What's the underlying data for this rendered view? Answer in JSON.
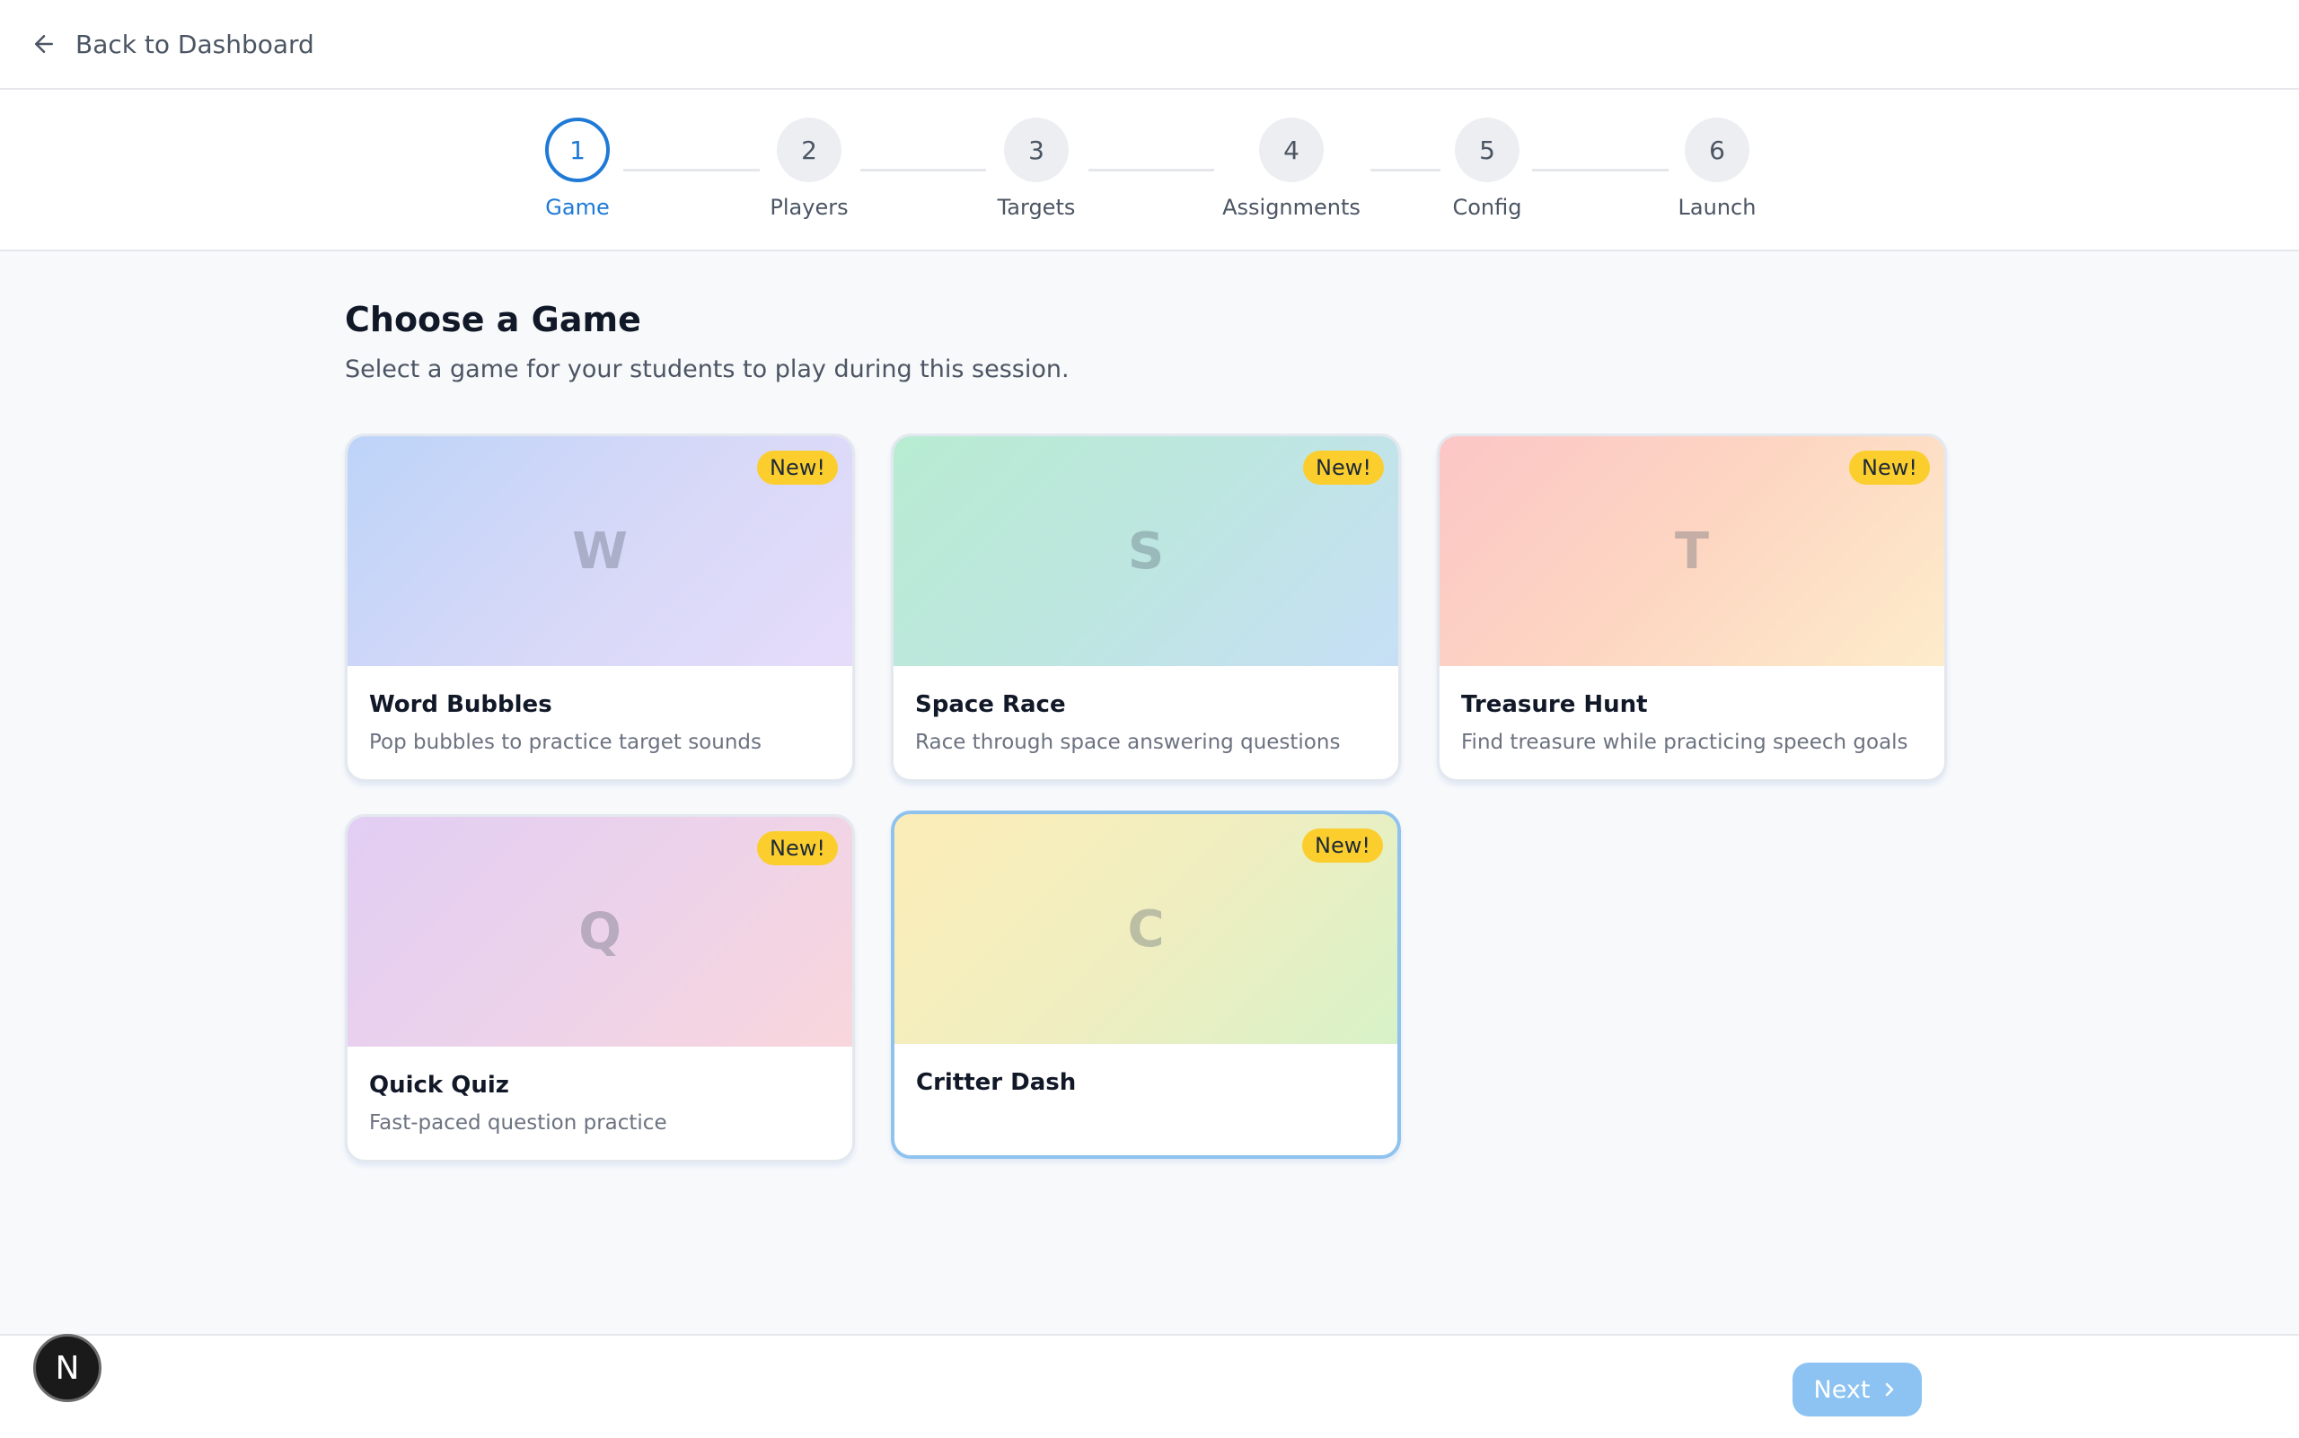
{
  "header": {
    "back_label": "Back to Dashboard"
  },
  "stepper": {
    "steps": [
      {
        "number": "1",
        "label": "Game",
        "active": true
      },
      {
        "number": "2",
        "label": "Players"
      },
      {
        "number": "3",
        "label": "Targets"
      },
      {
        "number": "4",
        "label": "Assignments"
      },
      {
        "number": "5",
        "label": "Config"
      },
      {
        "number": "6",
        "label": "Launch"
      }
    ]
  },
  "main": {
    "title": "Choose a Game",
    "subtitle": "Select a game for your students to play during this session.",
    "games": [
      {
        "letter": "W",
        "badge": "New!",
        "title": "Word Bubbles",
        "description": "Pop bubbles to practice target sounds"
      },
      {
        "letter": "S",
        "badge": "New!",
        "title": "Space Race",
        "description": "Race through space answering questions"
      },
      {
        "letter": "T",
        "badge": "New!",
        "title": "Treasure Hunt",
        "description": "Find treasure while practicing speech goals"
      },
      {
        "letter": "Q",
        "badge": "New!",
        "title": "Quick Quiz",
        "description": "Fast-paced question practice"
      },
      {
        "letter": "C",
        "badge": "New!",
        "title": "Critter Dash",
        "description": "",
        "selected": true
      }
    ]
  },
  "footer": {
    "next_label": "Next",
    "avatar_letter": "N"
  },
  "colors": {
    "accent": "#1e7ad6",
    "badge": "#fbce2e",
    "next_button": "#8cc3f2"
  }
}
